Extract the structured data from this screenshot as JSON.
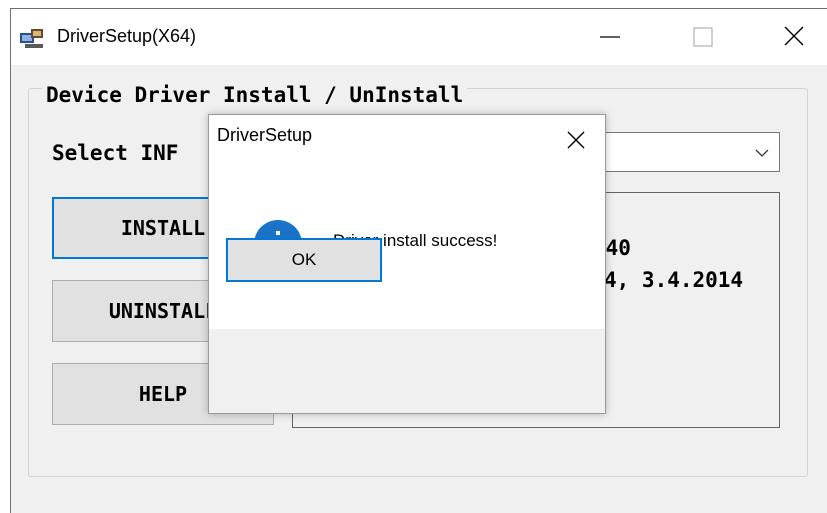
{
  "window": {
    "title": "DriverSetup(X64)",
    "icon": "driver-setup-app-icon",
    "controls": [
      "minimize-icon",
      "maximize-icon",
      "close-icon"
    ]
  },
  "main": {
    "group_title": "Device Driver Install / UnInstall",
    "select_label": "Select INF",
    "buttons": {
      "install": "INSTALL",
      "uninstall": "UNINSTALL",
      "help": "HELP"
    },
    "info_lines": [
      "340",
      "4, 3.4.2014"
    ]
  },
  "dialog": {
    "title": "DriverSetup",
    "message": "Driver install success!",
    "icon": "info-icon",
    "ok_label": "OK"
  },
  "colors": {
    "focus_border": "#0078d7",
    "info_icon": "#1a73c8",
    "button_face": "#e1e1e1",
    "window_bg": "#f0f0f0"
  }
}
